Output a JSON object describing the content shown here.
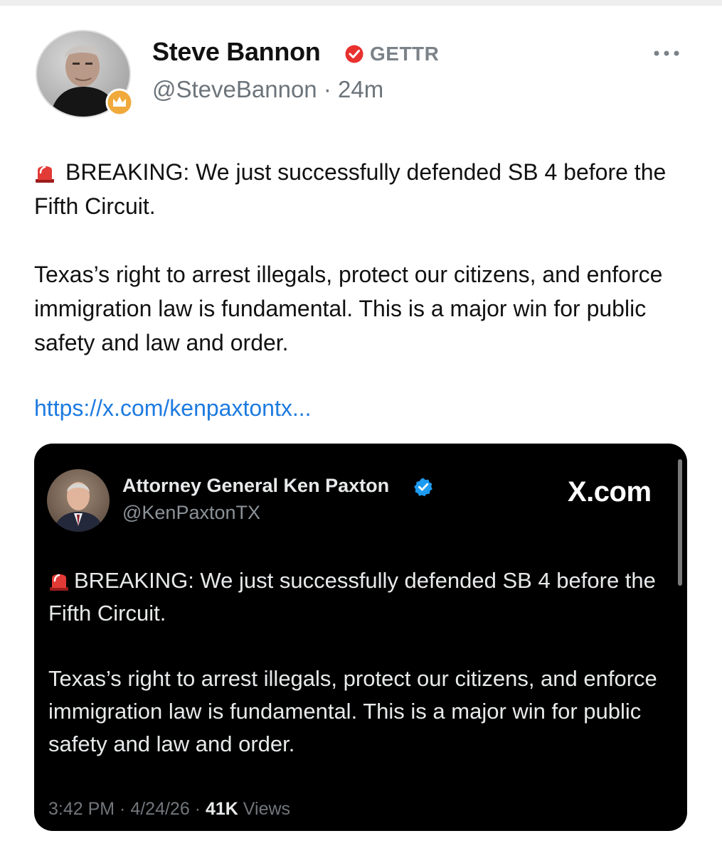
{
  "post": {
    "author": {
      "display_name": "Steve Bannon",
      "platform": "GETTR",
      "handle": "@SteveBannon",
      "time_ago": "24m",
      "separator": " · ",
      "verified_icon": "gettr-verified-flame-icon",
      "badge_icon": "crown-icon"
    },
    "body": {
      "line1": "BREAKING: We just successfully defended SB 4 before the Fifth Circuit.",
      "line2": "Texas’s right to arrest illegals, protect our citizens, and enforce immigration law is fundamental. This is a major win for public safety and law and order.",
      "emoji_icon": "siren-icon"
    },
    "link": "https://x.com/kenpaxtontx...",
    "more_icon": "more-horizontal-icon",
    "colors": {
      "link": "#1d7be0",
      "gettr_red": "#e8312f",
      "badge_orange": "#f0a93b"
    }
  },
  "embed": {
    "author": {
      "display_name": "Attorney General Ken Paxton",
      "handle": "@KenPaxtonTX",
      "verified_icon": "blue-check-icon"
    },
    "source_label": "X.com",
    "body": {
      "line1": "BREAKING: We just successfully defended SB 4 before the Fifth Circuit.",
      "line2": "Texas’s right to arrest illegals, protect our citizens, and enforce immigration law is fundamental. This is a major win for public safety and law and order."
    },
    "meta": {
      "time": "3:42 PM",
      "date": "4/24/26",
      "views_count": "41K",
      "views_label": "Views",
      "separator": " · "
    },
    "colors": {
      "background": "#000000",
      "verified_blue": "#1d9bf0"
    }
  }
}
